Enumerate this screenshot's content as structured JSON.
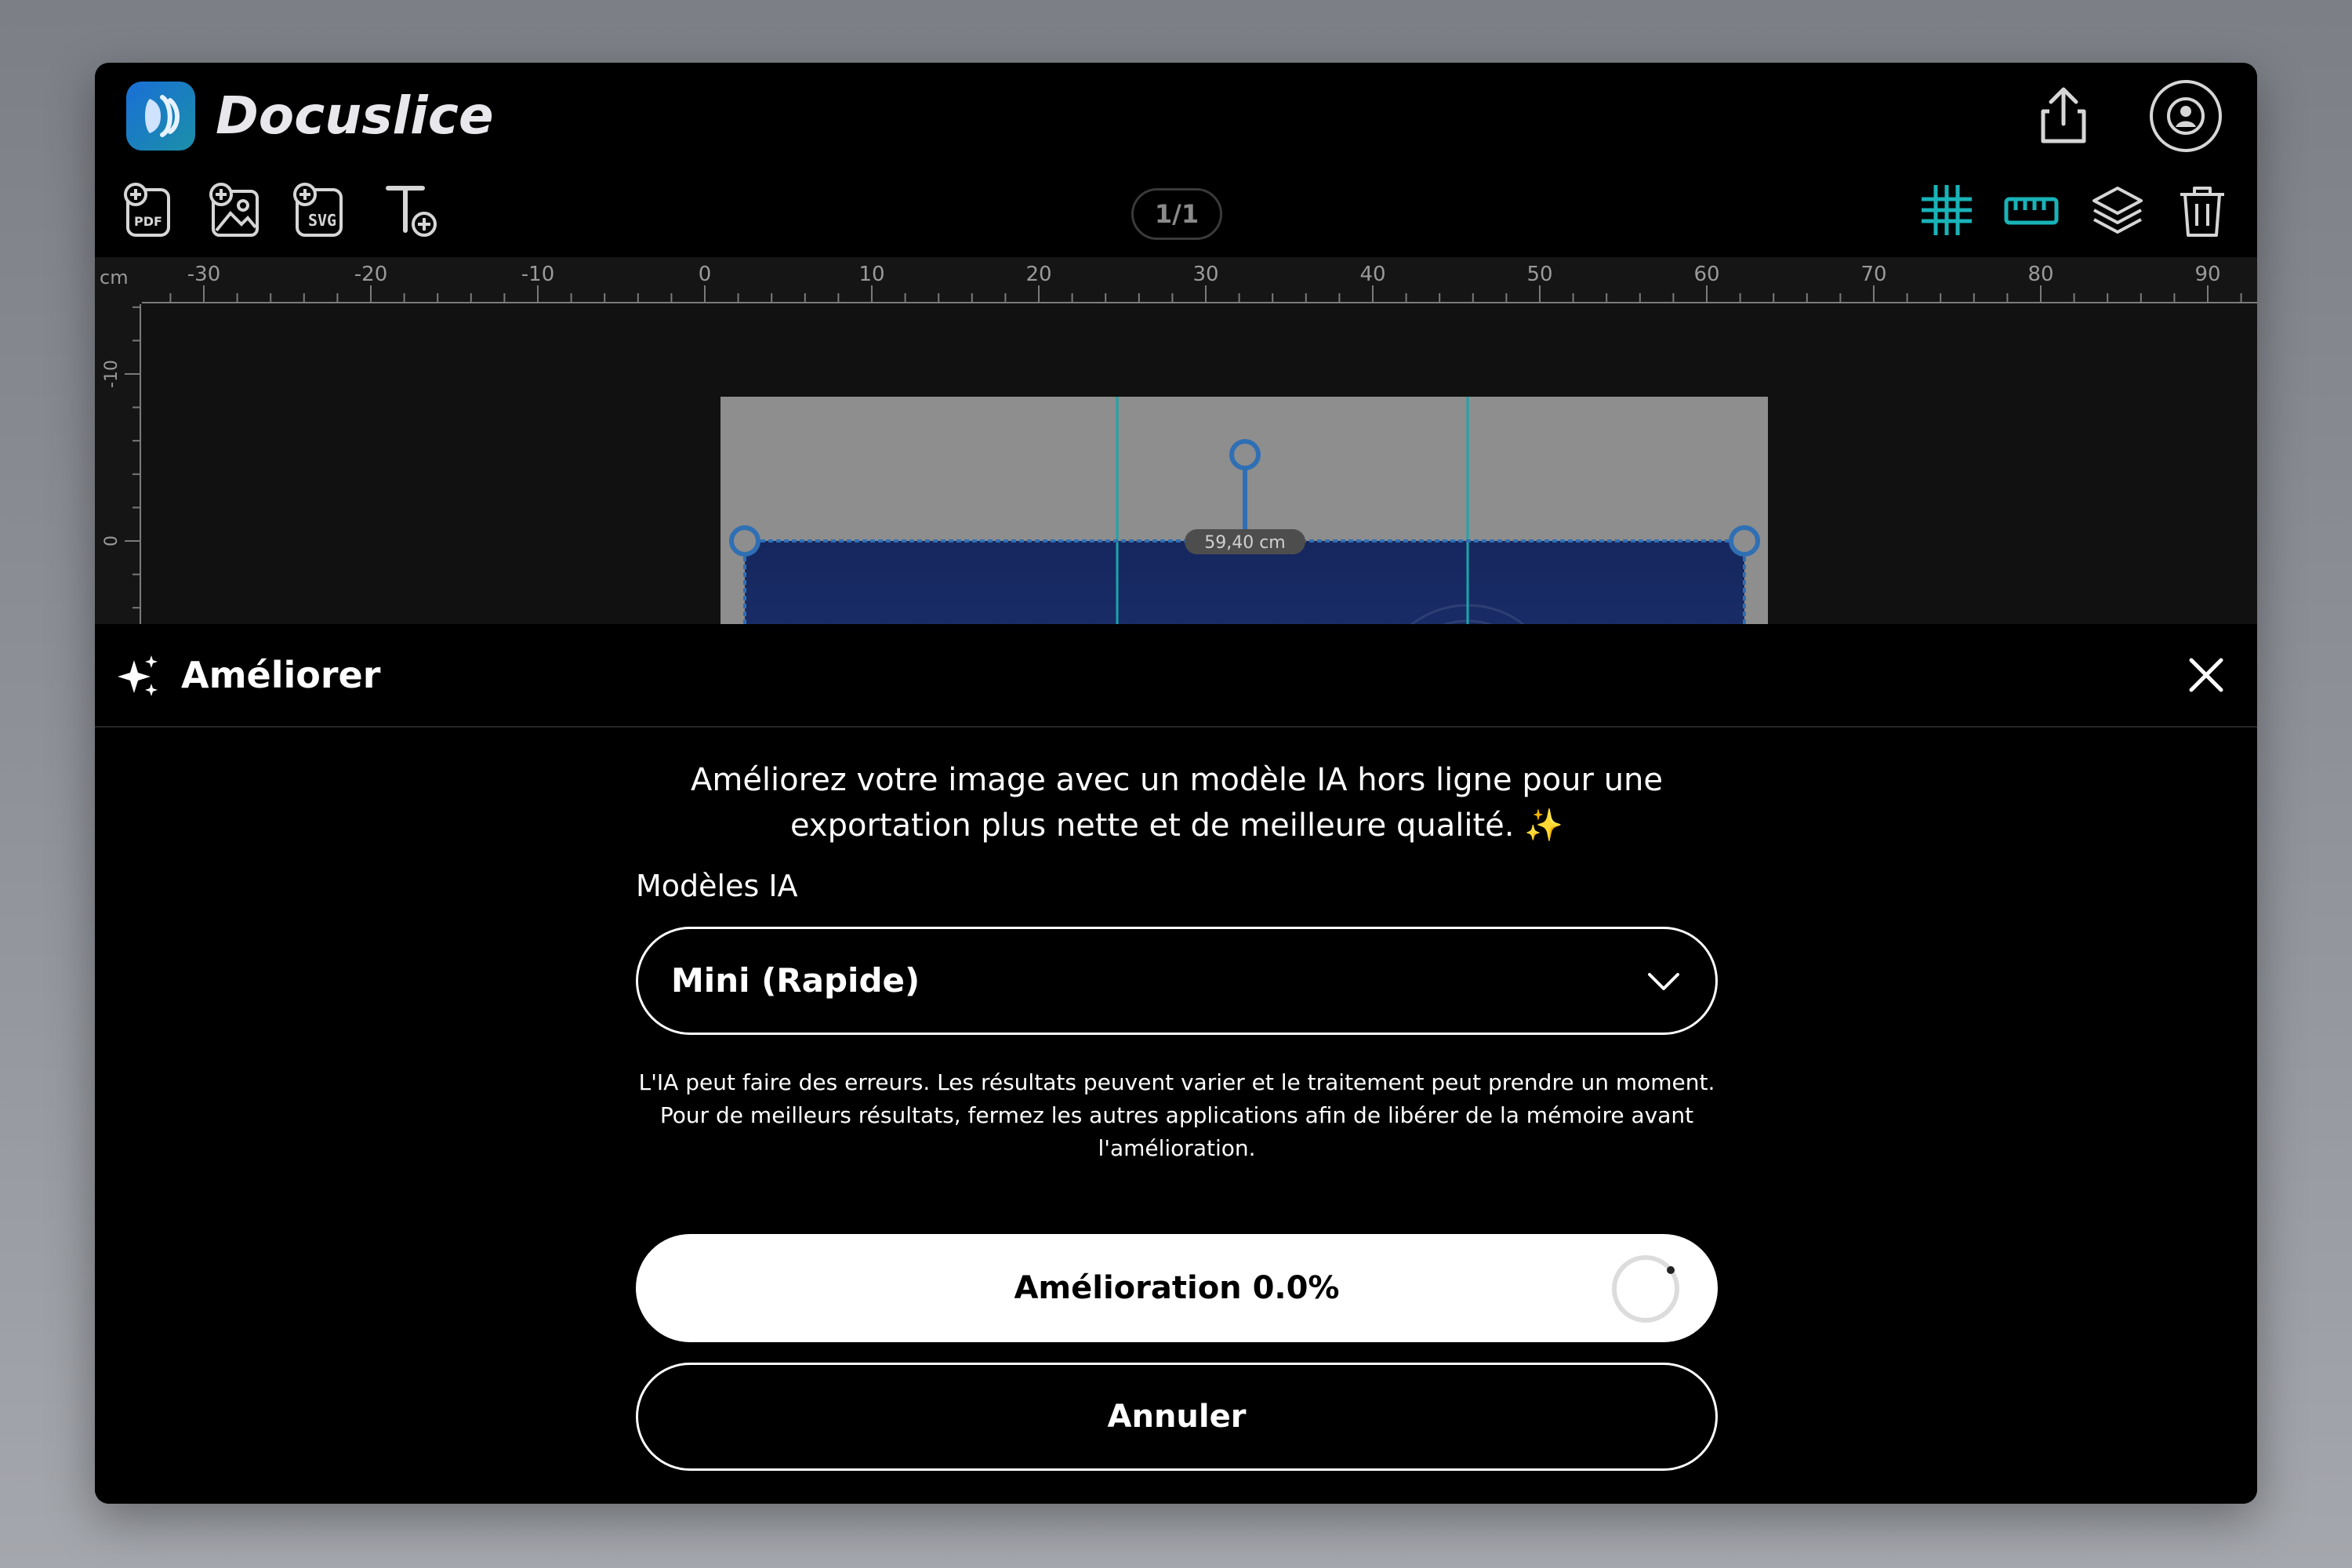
{
  "app": {
    "title": "Docuslice"
  },
  "toolbar": {
    "tools": [
      {
        "name": "add-pdf",
        "badge": "PDF"
      },
      {
        "name": "add-image",
        "badge": ""
      },
      {
        "name": "add-svg",
        "badge": "SVG"
      },
      {
        "name": "add-text",
        "badge": ""
      }
    ],
    "page_indicator": "1/1",
    "right_tools": [
      "grid-icon",
      "ruler-icon",
      "layers-icon",
      "trash-icon"
    ],
    "accent_color": "#19b3b8"
  },
  "ruler": {
    "unit": "cm",
    "top_labels": [
      "-30",
      "-20",
      "-10",
      "0",
      "10",
      "20",
      "30",
      "40",
      "50",
      "60",
      "70",
      "80",
      "90"
    ],
    "left_labels": [
      "-10",
      "0"
    ]
  },
  "canvas": {
    "width_label": "59,40 cm",
    "document_color": "#1b2f6b",
    "selection_color": "#2f6fb4"
  },
  "panel": {
    "title": "Améliorer",
    "description_line1": "Améliorez votre image avec un modèle IA hors ligne pour une",
    "description_line2": "exportation plus nette et de meilleure qualité. ✨",
    "models_label": "Modèles IA",
    "selected_model": "Mini (Rapide)",
    "note_line1": "L'IA peut faire des erreurs. Les résultats peuvent varier et le traitement peut prendre un moment.",
    "note_line2": "Pour de meilleurs résultats, fermez les autres applications afin de libérer de la mémoire avant",
    "note_line3": "l'amélioration.",
    "progress_label": "Amélioration 0.0%",
    "progress": 0.0,
    "cancel_label": "Annuler"
  }
}
